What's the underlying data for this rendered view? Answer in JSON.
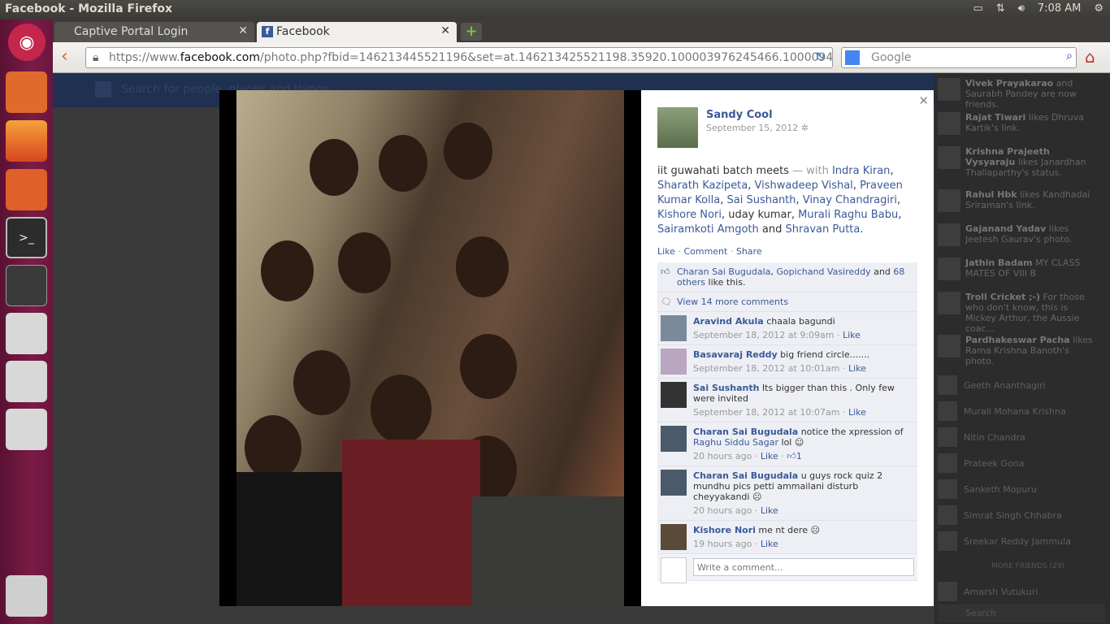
{
  "window": {
    "title": "Facebook - Mozilla Firefox",
    "time": "7:08 AM"
  },
  "tabs": [
    {
      "label": "Captive Portal Login"
    },
    {
      "label": "Facebook"
    }
  ],
  "nav": {
    "url_prefix": "https://www.",
    "url_domain": "facebook.com",
    "url_rest": "/photo.php?fbid=146213445521196&set=at.146213425521198.35920.100003976245466.1000094",
    "search_placeholder": "Google"
  },
  "fb": {
    "search_placeholder": "Search for people, places and things"
  },
  "post": {
    "author": "Sandy Cool",
    "date": "September 15, 2012",
    "caption": "iit guwahati batch meets",
    "with_label": "— with",
    "tagged": [
      "Indra Kiran",
      "Sharath Kazipeta",
      "Vishwadeep Vishal",
      "Praveen Kumar Kolla",
      "Sai Sushanth",
      "Vinay Chandragiri",
      "Kishore Nori"
    ],
    "untagged": "uday kumar",
    "tagged2": [
      "Murali Raghu Babu",
      "Sairamkoti Amgoth"
    ],
    "and_label": "and",
    "last_tag": "Shravan Putta",
    "actions": {
      "like": "Like",
      "comment": "Comment",
      "share": "Share"
    },
    "likes": {
      "names": [
        "Charan Sai Bugudala",
        "Gopichand Vasireddy"
      ],
      "and": "and",
      "others": "68 others",
      "suffix": "like this."
    },
    "view_more": "View 14 more comments",
    "comments": [
      {
        "name": "Aravind Akula",
        "text": "chaala bagundi",
        "time": "September 18, 2012 at 9:09am",
        "action": "Like"
      },
      {
        "name": "Basavaraj Reddy",
        "text": "big friend circle.......",
        "time": "September 18, 2012 at 10:01am",
        "action": "Like"
      },
      {
        "name": "Sai Sushanth",
        "text": "Its bigger than this . Only few were invited",
        "time": "September 18, 2012 at 10:07am",
        "action": "Like"
      },
      {
        "name": "Charan Sai Bugudala",
        "text": "notice the xpression of",
        "link": "Raghu Siddu Sagar",
        "text2": "lol",
        "time": "20 hours ago",
        "action": "Like",
        "likes": "1"
      },
      {
        "name": "Charan Sai Bugudala",
        "text": "u guys rock quiz 2 mundhu pics petti ammailani disturb cheyyakandi",
        "time": "20 hours ago",
        "action": "Like"
      },
      {
        "name": "Kishore Nori",
        "text": "me nt dere",
        "time": "19 hours ago",
        "action": "Like"
      }
    ],
    "write_placeholder": "Write a comment..."
  },
  "ticker": [
    {
      "name": "Vivek Prayakarao",
      "text": "and Saurabh Pandey are now friends."
    },
    {
      "name": "Rajat Tiwari",
      "text": "likes Dhruva Kartik's link."
    },
    {
      "name": "Krishna Prajeeth Vysyaraju",
      "text": "likes Janardhan Thallaparthy's status."
    },
    {
      "name": "Rahul Hbk",
      "text": "likes Kandhadai Sriraman's link."
    },
    {
      "name": "Gajanand Yadav",
      "text": "likes Jeetesh Gaurav's photo."
    },
    {
      "name": "Jathin Badam",
      "text": "MY CLASS MATES OF VIII B"
    },
    {
      "name": "Troll Cricket ;-)",
      "text": "For those who don't know, this is Mickey Arthur, the Aussie coac..."
    },
    {
      "name": "Pardhakeswar Pacha",
      "text": "likes Rama Krishna Banoth's photo."
    }
  ],
  "chat": [
    "Geeth Ananthagiri",
    "Murali Mohana Krishna",
    "Nitin Chandra",
    "Prateek Gona",
    "Sanketh Mopuru",
    "Simrat Singh Chhabra",
    "Sreekar Reddy Jammula",
    "Amarsh Vutukuri"
  ],
  "chat_more": "MORE FRIENDS (29)",
  "chat_search": "Search"
}
